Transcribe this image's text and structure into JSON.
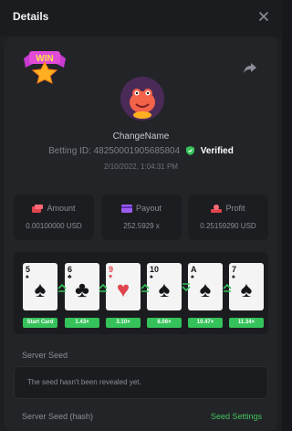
{
  "header": {
    "title": "Details"
  },
  "user": {
    "name": "ChangeName",
    "bet_id_label": "Betting ID:",
    "bet_id": "48250001905685804",
    "verified_label": "Verified",
    "date": "2/10/2022, 1:04:31 PM",
    "win_badge_text": "WIN"
  },
  "stats": {
    "amount": {
      "label": "Amount",
      "value": "0.00100000 USD"
    },
    "payout": {
      "label": "Payout",
      "value": "252.5929 x"
    },
    "profit": {
      "label": "Profit",
      "value": "0.25159290 USD"
    }
  },
  "cards": [
    {
      "rank": "5",
      "suit": "♠",
      "color": "black",
      "multiplier": "Start Card"
    },
    {
      "rank": "6",
      "suit": "♣",
      "color": "black",
      "multiplier": "1.43×"
    },
    {
      "rank": "9",
      "suit": "♥",
      "color": "red",
      "multiplier": "3.10×"
    },
    {
      "rank": "10",
      "suit": "♠",
      "color": "black",
      "multiplier": "8.06×"
    },
    {
      "rank": "A",
      "suit": "♠",
      "color": "black",
      "multiplier": "10.47×"
    },
    {
      "rank": "7",
      "suit": "♠",
      "color": "black",
      "multiplier": "11.34×"
    }
  ],
  "server_seed": {
    "label": "Server Seed",
    "placeholder": "The seed hasn't been revealed yet.",
    "hash_label": "Server Seed (hash)",
    "settings_link": "Seed Settings"
  },
  "colors": {
    "accent_green": "#35c25a",
    "card_red": "#e0454f",
    "panel": "#232428"
  }
}
